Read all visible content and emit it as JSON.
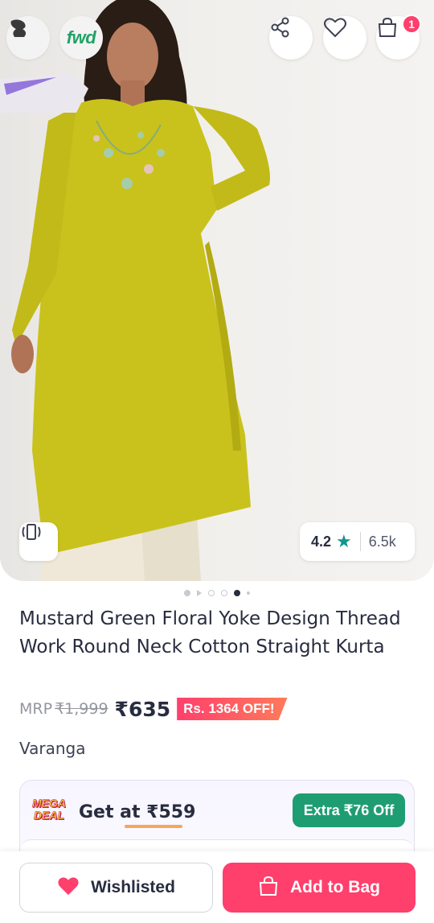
{
  "header": {
    "fwd_logo_text": "fwd",
    "bag_count": "1",
    "icons": [
      "profile-icon",
      "share-icon",
      "heart-icon",
      "bag-icon"
    ]
  },
  "image": {
    "rating": "4.2",
    "rating_count": "6.5k",
    "carousel": {
      "total_slides": 6,
      "active_index": 4
    }
  },
  "product": {
    "title": "Mustard Green Floral Yoke Design Thread Work Round Neck Cotton Straight Kurta",
    "mrp_label": "MRP",
    "mrp_value": "₹1,999",
    "price": "₹635",
    "off_text": "Rs. 1364 OFF!",
    "brand": "Varanga"
  },
  "deal": {
    "badge_line1": "MEGA",
    "badge_line2": "DEAL",
    "get_at_label": "Get at ₹559",
    "extra_off": "Extra ₹76 Off"
  },
  "actions": {
    "wishlist_label": "Wishlisted",
    "add_to_bag_label": "Add to Bag"
  },
  "colors": {
    "accent": "#ff3f6c",
    "rating_star": "#14958f",
    "extra_off_bg": "#1f9d72",
    "kurta": "#c9c21c"
  }
}
